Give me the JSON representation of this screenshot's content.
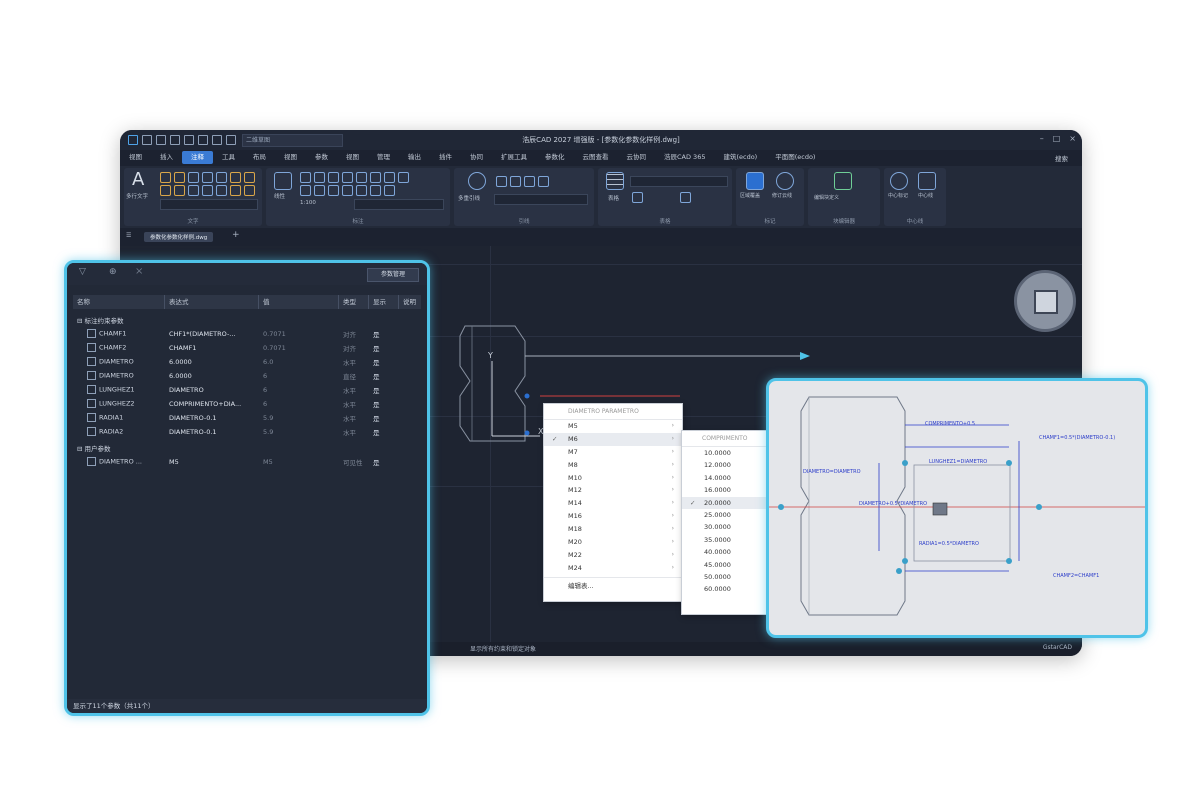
{
  "app": {
    "title": "浩辰CAD 2027 增强版 - [参数化参数化样例.dwg]",
    "workspace": "二维草图",
    "right_menu": "搜索"
  },
  "menubar": [
    "视图",
    "插入",
    "注释",
    "工具",
    "布局",
    "视图",
    "参数",
    "视图",
    "管理",
    "输出",
    "插件",
    "协同",
    "扩展工具",
    "参数化",
    "云图查看",
    "云协同",
    "浩辰CAD 365",
    "建筑(ecdo)",
    "平面图(ecdo)"
  ],
  "ribbon": {
    "groups": [
      "文字",
      "标注",
      "引线",
      "表格",
      "标记",
      "块编辑器",
      "中心线"
    ],
    "labels": [
      "多行文字",
      "线性",
      "多重引线",
      "表格",
      "区域覆盖",
      "修订云线",
      "编辑块定义",
      "块编辑器",
      "中心标记",
      "中心线"
    ],
    "dim_scale": "1:100",
    "doc_tab": "参数化参数化样例.dwg"
  },
  "status": {
    "center": "显示所有约束和锁定对象",
    "right": "GstarCAD"
  },
  "panel": {
    "button": "参数管理",
    "headers": [
      "名称",
      "表达式",
      "值",
      "类型",
      "显示",
      "说明"
    ],
    "groups": [
      "标注约束参数",
      "用户参数"
    ],
    "rows": [
      {
        "name": "CHAMF1",
        "expr": "CHF1*(DIAMETRO-...",
        "value": "0.7071",
        "type": "对齐",
        "show": "是",
        "dim": true
      },
      {
        "name": "CHAMF2",
        "expr": "CHAMF1",
        "value": "0.7071",
        "type": "对齐",
        "show": "是",
        "dim": true
      },
      {
        "name": "DIAMETRO",
        "expr": "6.0000",
        "value": "6.0",
        "type": "水平",
        "show": "是",
        "dim": false
      },
      {
        "name": "DIAMETRO",
        "expr": "6.0000",
        "value": "6",
        "type": "直径",
        "show": "是",
        "dim": false
      },
      {
        "name": "LUNGHEZ1",
        "expr": "DIAMETRO",
        "value": "6",
        "type": "水平",
        "show": "是",
        "dim": false
      },
      {
        "name": "LUNGHEZ2",
        "expr": "COMPRIMENTO+DIA...",
        "value": "6",
        "type": "水平",
        "show": "是",
        "dim": false
      },
      {
        "name": "RADIA1",
        "expr": "DIAMETRO-0.1",
        "value": "5.9",
        "type": "水平",
        "show": "是",
        "dim": false
      },
      {
        "name": "RADIA2",
        "expr": "DIAMETRO-0.1",
        "value": "5.9",
        "type": "水平",
        "show": "是",
        "dim": false
      }
    ],
    "user_rows": [
      {
        "name": "DIAMETRO ...",
        "expr": "M5",
        "value": "M5",
        "type": "可见性",
        "show": "是"
      }
    ],
    "status": "显示了11个参数（共11个）"
  },
  "menu_size": {
    "header": "DIAMETRO PARAMETRO",
    "items": [
      "M5",
      "M6",
      "M7",
      "M8",
      "M10",
      "M12",
      "M14",
      "M16",
      "M18",
      "M20",
      "M22",
      "M24"
    ],
    "selected": "M6",
    "footer": "编辑表..."
  },
  "menu_length": {
    "header": "COMPRIMENTO",
    "items": [
      "10.0000",
      "12.0000",
      "14.0000",
      "16.0000",
      "20.0000",
      "25.0000",
      "30.0000",
      "35.0000",
      "40.0000",
      "45.0000",
      "50.0000",
      "60.0000"
    ],
    "selected": "20.0000"
  },
  "preview": {
    "labels": [
      "COMPRIMENTO+0.5",
      "CHAMF1=0.5*(DIAMETRO-0.1)",
      "LUNGHEZ1=DIAMETRO",
      "DIAMETRO=DIAMETRO",
      "DIAMETRO+0.5*DIAMETRO",
      "RADIA1=0.5*DIAMETRO",
      "CHAMF2=CHAMF1"
    ]
  },
  "colors": {
    "accent": "#4fc3e8",
    "selection": "#3a7bd5",
    "constraint": "#2b3cc9"
  }
}
